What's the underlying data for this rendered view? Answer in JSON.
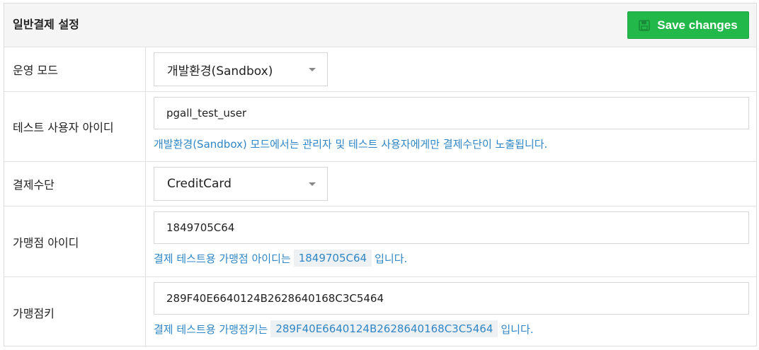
{
  "header": {
    "title": "일반결제 설정",
    "save_label": "Save changes",
    "save_icon": "floppy-disk-icon"
  },
  "mode": {
    "label": "운영 모드",
    "value": "개발환경(Sandbox)"
  },
  "test_user": {
    "label": "테스트 사용자 아이디",
    "value": "pgall_test_user",
    "help": "개발환경(Sandbox) 모드에서는 관리자 및 테스트 사용자에게만 결제수단이 노출됩니다."
  },
  "payment_method": {
    "label": "결제수단",
    "value": "CreditCard"
  },
  "merchant_id": {
    "label": "가맹점 아이디",
    "value": "1849705C64",
    "help_prefix": "결제 테스트용 가맹점 아이디는",
    "help_code": "1849705C64",
    "help_suffix": "입니다."
  },
  "merchant_key": {
    "label": "가맹점키",
    "value": "289F40E6640124B2628640168C3C5464",
    "help_prefix": "결제 테스트용 가맹점키는",
    "help_code": "289F40E6640124B2628640168C3C5464",
    "help_suffix": "입니다."
  },
  "colors": {
    "save_button": "#22b84a",
    "help_text": "#2f86c6",
    "header_bg": "#f5f5f5"
  }
}
